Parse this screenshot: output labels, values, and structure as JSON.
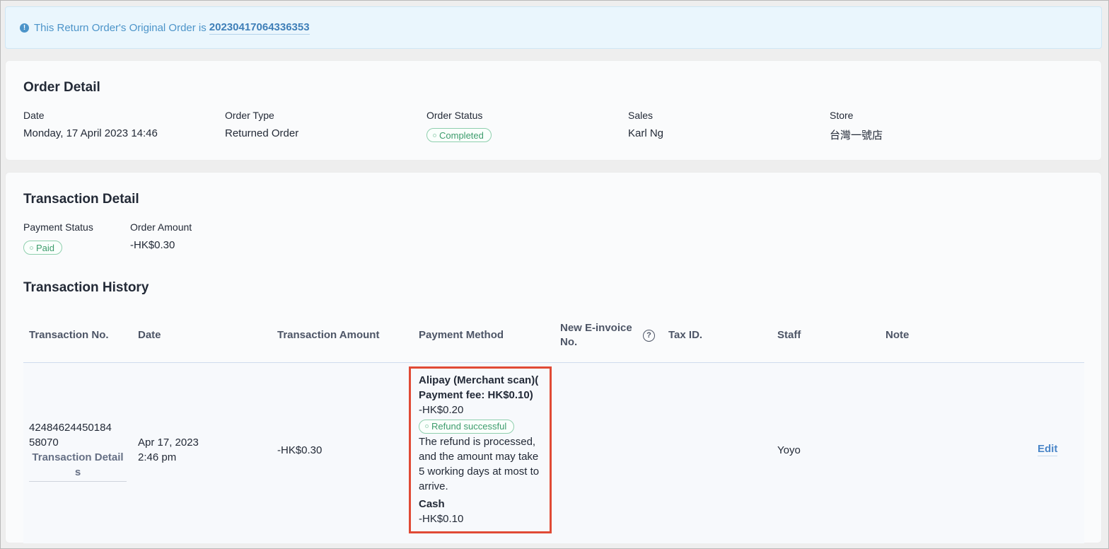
{
  "alert": {
    "text": "This Return Order's Original Order is",
    "order_no": "20230417064336353"
  },
  "order_detail": {
    "title": "Order Detail",
    "fields": {
      "date": {
        "label": "Date",
        "value": "Monday, 17 April 2023 14:46"
      },
      "order_type": {
        "label": "Order Type",
        "value": "Returned Order"
      },
      "order_status": {
        "label": "Order Status",
        "value": "Completed"
      },
      "sales": {
        "label": "Sales",
        "value": "Karl Ng"
      },
      "store": {
        "label": "Store",
        "value": "台灣一號店"
      }
    }
  },
  "transaction_detail": {
    "title": "Transaction Detail",
    "payment_status": {
      "label": "Payment Status",
      "value": "Paid"
    },
    "order_amount": {
      "label": "Order Amount",
      "value": "-HK$0.30"
    }
  },
  "transaction_history": {
    "title": "Transaction History",
    "columns": {
      "transaction_no": "Transaction No.",
      "date": "Date",
      "amount": "Transaction Amount",
      "payment_method": "Payment Method",
      "einvoice_line1": "New E-invoice",
      "einvoice_line2": "No.",
      "tax_id": "Tax ID.",
      "staff": "Staff",
      "note": "Note"
    },
    "rows": [
      {
        "transaction_no_line1": "42484624450184",
        "transaction_no_line2": "58070",
        "details_link_line1": "Transaction Detail",
        "details_link_line2": "s",
        "date_line1": "Apr 17, 2023",
        "date_line2": "2:46 pm",
        "amount": "-HK$0.30",
        "payment_methods": {
          "alipay_line1": "Alipay (Merchant scan)(",
          "alipay_line2": "Payment fee: HK$0.10)",
          "alipay_amount": "-HK$0.20",
          "refund_status": "Refund successful",
          "refund_note_line1": "The refund is processed,",
          "refund_note_line2": "and the amount may take",
          "refund_note_line3": "5 working days at most to",
          "refund_note_line4": "arrive.",
          "cash_label": "Cash",
          "cash_amount": "-HK$0.10"
        },
        "staff": "Yoyo",
        "action": "Edit"
      }
    ]
  },
  "colors": {
    "accent_green": "#3d9c6c",
    "link_blue": "#4a86c8",
    "highlight_red": "#e04a35",
    "alert_bg": "#eaf6fd"
  },
  "icons": {
    "alert": "info-circle-icon",
    "help": "question-circle-icon"
  }
}
